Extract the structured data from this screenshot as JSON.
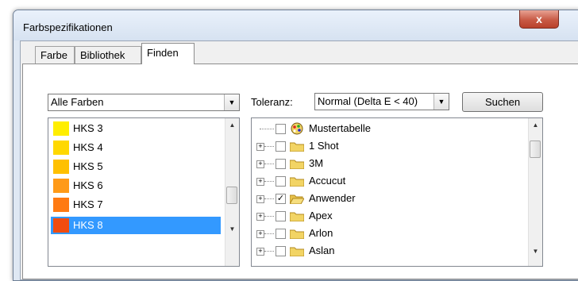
{
  "window": {
    "title": "Farbspezifikationen",
    "close_glyph": "x"
  },
  "tabs": [
    {
      "label": "Farbe"
    },
    {
      "label": "Bibliothek"
    },
    {
      "label": "Finden"
    }
  ],
  "search": {
    "filter_value": "Alle Farben",
    "tolerance_label": "Toleranz:",
    "tolerance_value": "Normal (Delta E < 40)",
    "search_button": "Suchen"
  },
  "color_list": [
    {
      "name": "HKS 3",
      "color": "#ffee00"
    },
    {
      "name": "HKS 4",
      "color": "#ffd800"
    },
    {
      "name": "HKS 5",
      "color": "#ffc000"
    },
    {
      "name": "HKS 6",
      "color": "#ff9a18"
    },
    {
      "name": "HKS 7",
      "color": "#ff7a12"
    },
    {
      "name": "HKS 8",
      "color": "#f04c10",
      "selected": true
    }
  ],
  "tree": [
    {
      "label": "Mustertabelle",
      "icon": "palette-icon",
      "checked": false,
      "expander": false
    },
    {
      "label": "1 Shot",
      "icon": "folder-icon",
      "checked": false,
      "expander": true
    },
    {
      "label": "3M",
      "icon": "folder-icon",
      "checked": false,
      "expander": true
    },
    {
      "label": "Accucut",
      "icon": "folder-icon",
      "checked": false,
      "expander": true
    },
    {
      "label": "Anwender",
      "icon": "folder-open-icon",
      "checked": true,
      "expander": true
    },
    {
      "label": "Apex",
      "icon": "folder-icon",
      "checked": false,
      "expander": true
    },
    {
      "label": "Arlon",
      "icon": "folder-icon",
      "checked": false,
      "expander": true
    },
    {
      "label": "Aslan",
      "icon": "folder-icon",
      "checked": false,
      "expander": true
    }
  ],
  "colors": {
    "selection": "#3399ff",
    "folder": "#f2d464"
  }
}
